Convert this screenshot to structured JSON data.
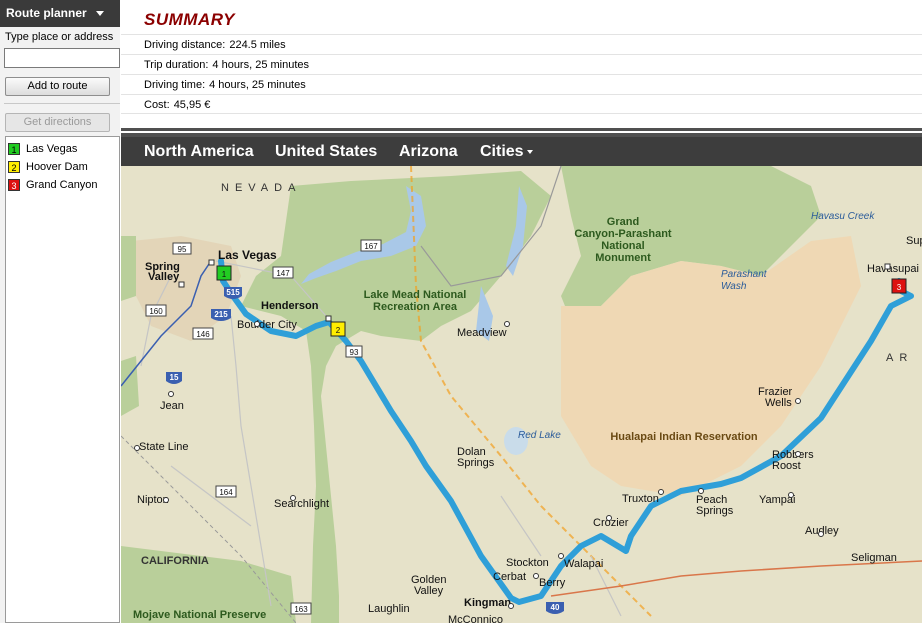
{
  "left_panel": {
    "header": "Route planner",
    "address_label": "Type place or address",
    "address_value": "",
    "add_button": "Add to route",
    "directions_button": "Get directions",
    "stops": [
      {
        "num": "1",
        "name": "Las Vegas",
        "color": "#22cc22"
      },
      {
        "num": "2",
        "name": "Hoover Dam",
        "color": "#ffee00"
      },
      {
        "num": "3",
        "name": "Grand Canyon",
        "color": "#dd1111"
      }
    ]
  },
  "summary": {
    "title": "SUMMARY",
    "rows": [
      {
        "label": "Driving distance:",
        "value": "224.5 miles"
      },
      {
        "label": "Trip duration:",
        "value": "4 hours, 25 minutes"
      },
      {
        "label": "Driving time:",
        "value": "4 hours, 25 minutes"
      },
      {
        "label": "Cost:",
        "value": "45,95 €"
      }
    ]
  },
  "breadcrumb": [
    "North America",
    "United States",
    "Arizona",
    "Cities"
  ],
  "map": {
    "state_labels": [
      "NEVADA",
      "CALIFORNIA",
      "AR"
    ],
    "cities": [
      "Las Vegas",
      "Spring",
      "Valley",
      "Henderson",
      "Boulder City",
      "Jean",
      "State Line",
      "Nipton",
      "Searchlight",
      "Golden",
      "Valley",
      "Kingman",
      "McConnico",
      "Laughlin",
      "Stockton",
      "Cerbat",
      "Berry",
      "Walapai",
      "Crozier",
      "Truxton",
      "Peach",
      "Springs",
      "Yampai",
      "Audley",
      "Seligman",
      "Robbers",
      "Roost",
      "Frazier",
      "Wells",
      "Meadview",
      "Dolan",
      "Springs",
      "Havasupai",
      "Sup"
    ],
    "parks": [
      "Lake Mead National",
      "Recreation Area",
      "Grand",
      "Canyon-Parashant",
      "National",
      "Monument",
      "Mojave National Preserve"
    ],
    "reservation": "Hualapai Indian Reservation",
    "water": [
      "Havasu Creek",
      "Parashant",
      "Wash",
      "Red Lake"
    ],
    "route_shields": [
      "95",
      "147",
      "167",
      "160",
      "146",
      "215",
      "515",
      "93",
      "15",
      "164",
      "163",
      "40"
    ],
    "colors": {
      "land": "#e6e2c9",
      "park": "#b9cf9a",
      "reservation": "#efd8b4",
      "water": "#a9c8e8",
      "route": "#2f9fd8",
      "interstate": "#3a5fb0"
    }
  }
}
